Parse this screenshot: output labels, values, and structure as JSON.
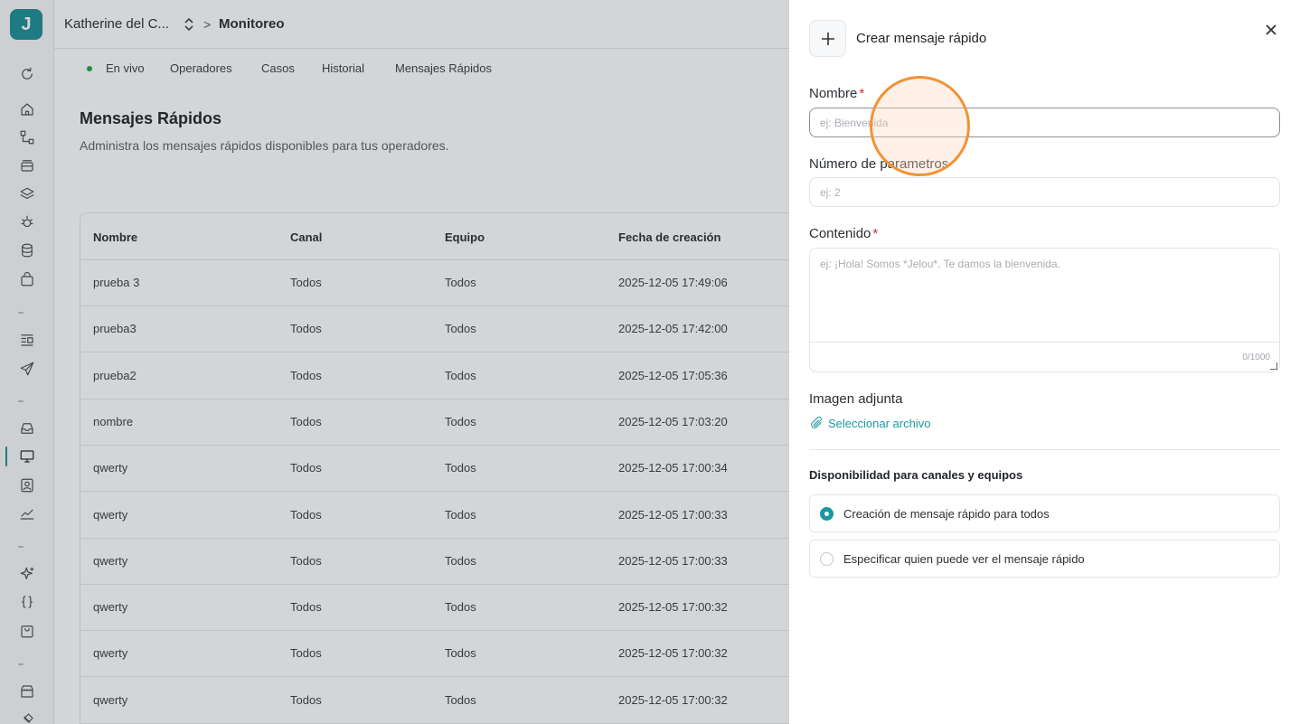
{
  "app": {
    "logo_letter": "J"
  },
  "sidebar": {
    "icons": [
      "refresh-icon",
      "home-icon",
      "flow-icon",
      "inbox-stack-icon",
      "layers-icon",
      "bug-icon",
      "database-icon",
      "bag-icon",
      "list-icon",
      "send-icon",
      "inbox-icon",
      "monitor-icon",
      "contact-icon",
      "chart-icon",
      "sparkle-icon",
      "braces-icon",
      "shopping-bag-icon",
      "store-icon",
      "plug-icon"
    ]
  },
  "header": {
    "org": "Katherine del C...",
    "separator": ">",
    "page": "Monitoreo"
  },
  "tabs": [
    {
      "label": "En vivo"
    },
    {
      "label": "Operadores"
    },
    {
      "label": "Casos"
    },
    {
      "label": "Historial"
    },
    {
      "label": "Mensajes Rápidos"
    }
  ],
  "main": {
    "title": "Mensajes Rápidos",
    "subtitle": "Administra los mensajes rápidos disponibles para tus operadores."
  },
  "table": {
    "columns": [
      "Nombre",
      "Canal",
      "Equipo",
      "Fecha de creación"
    ],
    "rows": [
      [
        "prueba 3",
        "Todos",
        "Todos",
        "2025-12-05 17:49:06"
      ],
      [
        "prueba3",
        "Todos",
        "Todos",
        "2025-12-05 17:42:00"
      ],
      [
        "prueba2",
        "Todos",
        "Todos",
        "2025-12-05 17:05:36"
      ],
      [
        "nombre",
        "Todos",
        "Todos",
        "2025-12-05 17:03:20"
      ],
      [
        "qwerty",
        "Todos",
        "Todos",
        "2025-12-05 17:00:34"
      ],
      [
        "qwerty",
        "Todos",
        "Todos",
        "2025-12-05 17:00:33"
      ],
      [
        "qwerty",
        "Todos",
        "Todos",
        "2025-12-05 17:00:33"
      ],
      [
        "qwerty",
        "Todos",
        "Todos",
        "2025-12-05 17:00:32"
      ],
      [
        "qwerty",
        "Todos",
        "Todos",
        "2025-12-05 17:00:32"
      ],
      [
        "qwerty",
        "Todos",
        "Todos",
        "2025-12-05 17:00:32"
      ]
    ]
  },
  "drawer": {
    "title": "Crear mensaje rápido",
    "name_label": "Nombre",
    "required_mark": "*",
    "name_placeholder": "ej: Bienvenida",
    "params_label": "Número de parametros",
    "params_placeholder": "ej: 2",
    "content_label": "Contenido",
    "content_placeholder": "ej: ¡Hola! Somos *Jelou*. Te damos la bienvenida.",
    "content_counter": "0/1000",
    "image_label": "Imagen adjunta",
    "select_file": "Seleccionar archivo",
    "availability_title": "Disponibilidad para canales y equipos",
    "options": [
      {
        "label": "Creación de mensaje rápido para todos",
        "selected": true
      },
      {
        "label": "Especificar quien puede ver el mensaje rápido",
        "selected": false
      }
    ]
  },
  "colors": {
    "accent": "#1c98a2",
    "required": "#d22b2b",
    "live": "#1aa64a",
    "cursor_ring": "#f29233"
  }
}
